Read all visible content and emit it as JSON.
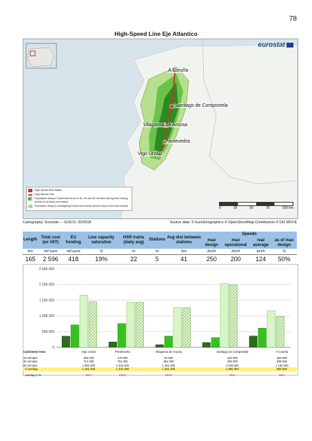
{
  "page_number": "78",
  "title": "High-Speed Line Eje Atlantico",
  "map": {
    "brand": "eurostat",
    "cities": [
      "A Coruña",
      "Santiago de Compostela",
      "Vilagarcia de Arousa",
      "Pontevedra",
      "Vigo Urzaiz"
    ],
    "legend": [
      "High Speed Rail Station",
      "High Speed Line",
      "Population living in Catchment Area of 15, 30 and 60 minutes driving time having access to at least one station",
      "Population living in overlapping Catchment Areas (shown only in the chart below)"
    ],
    "scale": [
      "0",
      "25",
      "50",
      "75",
      "100 km"
    ],
    "credit_left": "Cartography: Eurostat — GISCO, 02/2018",
    "credit_right": "Source data: © EuroGeographics © OpenStreetMap Contributors © DG MOVE"
  },
  "stats_table": {
    "headers": [
      "Length",
      "Total cost (ex VAT)",
      "EU funding",
      "Line capacity saturation",
      "HSR trains (daily avg)",
      "Stations",
      "Avg dist between stations",
      "max design",
      "max operational",
      "real average",
      "as of max design"
    ],
    "speeds_header": "Speeds",
    "units": [
      "km",
      "mil euro",
      "mil euro",
      "%",
      "nr",
      "nr",
      "km",
      "km/h",
      "km/h",
      "km/h",
      "%"
    ],
    "values": [
      "165",
      "2 596",
      "418",
      "19%",
      "22",
      "5",
      "41",
      "250",
      "200",
      "124",
      "50%"
    ]
  },
  "chart_data": {
    "type": "bar",
    "categories": [
      "Vigo Urzaiz",
      "Pontevedra",
      "Vilagarcia de Arousa",
      "Santiago de Compostela",
      "A Coruña"
    ],
    "series": [
      {
        "name": "15 minutes",
        "values": [
          353000,
          170000,
          82000,
          153000,
          359000
        ]
      },
      {
        "name": "30 minutes",
        "values": [
          712000,
          754000,
          354000,
          308000,
          608000
        ]
      },
      {
        "name": "60 minutes",
        "values": [
          1660000,
          1432000,
          1261000,
          2028000,
          1163000
        ]
      },
      {
        "name": "- in overlap",
        "values": [
          1452000,
          1431000,
          1261000,
          1985000,
          983000
        ]
      }
    ],
    "ylim": [
      0,
      2500000
    ],
    "yticks": [
      "0",
      "500 000",
      "1 000 000",
      "1 500 000",
      "2 000 000",
      "2 500 000"
    ],
    "grid": true
  },
  "chart_table": {
    "row_header": "Catchment Area",
    "columns": [
      "Vigo Urzaiz",
      "Pontevedra",
      "Vilagarcia de Arousa",
      "Santiago de Compostela",
      "A Coruña"
    ],
    "rows": [
      {
        "label": "15 minutes",
        "cells": [
          "353 000",
          "170 000",
          "82 000",
          "153 000",
          "359 000"
        ]
      },
      {
        "label": "30 minutes",
        "cells": [
          "712 000",
          "754 000",
          "354 000",
          "308 000",
          "608 000"
        ]
      },
      {
        "label": "60 minutes",
        "cells": [
          "1 660 000",
          "1 432 000",
          "1 261 000",
          "2 028 000",
          "1 163 000"
        ]
      },
      {
        "label": "- in overlap",
        "cells": [
          "1 452 000",
          "1 431 000",
          "1 261 000",
          "1 985 000",
          "983 000"
        ]
      },
      {
        "label": "- overlap in %",
        "cells": [
          "88%",
          "100%",
          "100%",
          "98%",
          "85%"
        ]
      }
    ]
  },
  "colors": {
    "dark": "#2f6b1e",
    "mid": "#35c21d",
    "light": "#d8f6c5",
    "hatch": "#9fcf7a",
    "header": "#9bc2e6",
    "line": "#c0392b"
  }
}
